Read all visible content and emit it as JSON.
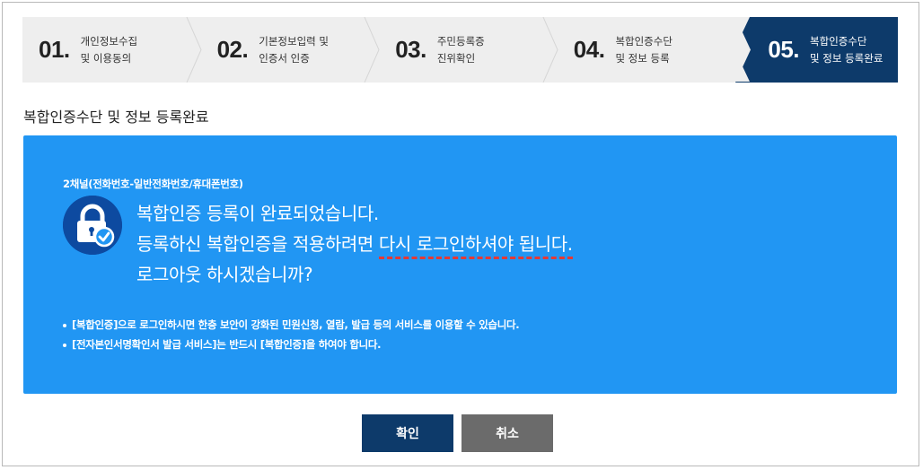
{
  "steps": [
    {
      "num": "01.",
      "line1": "개인정보수집",
      "line2": "및 이용동의",
      "active": false
    },
    {
      "num": "02.",
      "line1": "기본정보입력 및",
      "line2": "인증서 인증",
      "active": false
    },
    {
      "num": "03.",
      "line1": "주민등록증",
      "line2": "진위확인",
      "active": false
    },
    {
      "num": "04.",
      "line1": "복합인증수단",
      "line2": "및 정보 등록",
      "active": false
    },
    {
      "num": "05.",
      "line1": "복합인증수단",
      "line2": "및 정보 등록완료",
      "active": true
    }
  ],
  "section_title": "복합인증수단 및 정보 등록완료",
  "panel": {
    "channel": "2채널(전화번호-일반전화번호/휴대폰번호)",
    "line1": "복합인증 등록이 완료되었습니다.",
    "line2_prefix": "등록하신 복합인증을 적용하려면 ",
    "line2_underlined": "다시 로그인하셔야 됩니다.",
    "line3": "로그아웃 하시겠습니까?",
    "notes": [
      "[복합인증]으로 로그인하시면 한층 보안이 강화된 민원신청, 열람, 발급 등의 서비스를 이용할 수 있습니다.",
      "[전자본인서명확인서 발급 서비스]는 반드시 [복합인증]을 하여야 합니다."
    ],
    "icon": "lock-check-icon"
  },
  "buttons": {
    "ok": "확인",
    "cancel": "취소"
  },
  "colors": {
    "navy": "#0d3a6a",
    "panel_blue": "#2196f3",
    "dashed_red": "#e53935",
    "gray_button": "#6b6b6b"
  }
}
